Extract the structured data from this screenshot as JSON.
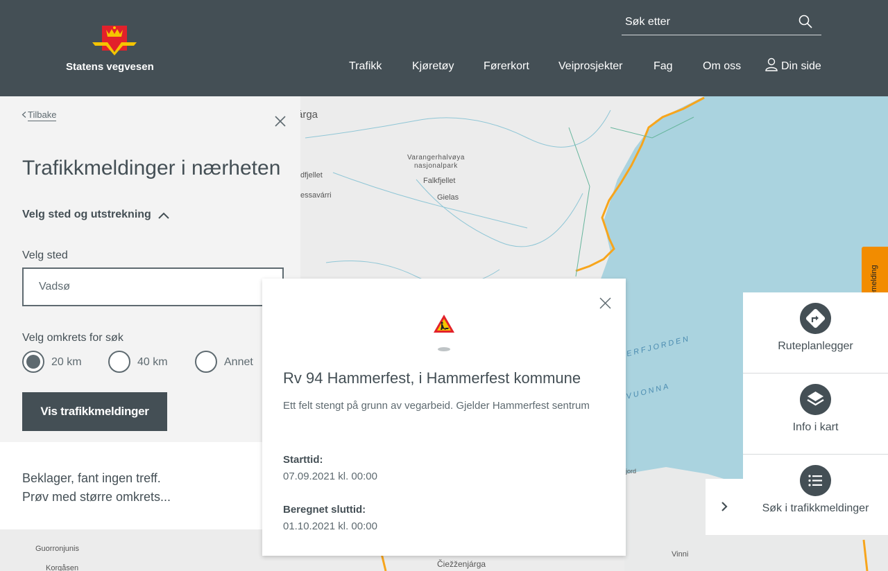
{
  "header": {
    "logo_text": "Statens vegvesen",
    "search_placeholder": "Søk etter",
    "nav": [
      "Trafikk",
      "Kjøretøy",
      "Førerkort",
      "Veiprosjekter",
      "Fag",
      "Om oss",
      "Din side"
    ]
  },
  "panel": {
    "back_label": "Tilbake",
    "title": "Trafikkmeldinger i nærheten",
    "section_label": "Velg sted og utstrekning",
    "place_label": "Velg sted",
    "place_value": "Vadsø",
    "radius_label": "Velg omkrets for søk",
    "radius_options": [
      "20 km",
      "40 km",
      "Annet"
    ],
    "radius_selected": "20 km",
    "submit_label": "Vis trafikkmeldinger",
    "empty_line1": "Beklager, fant ingen treff.",
    "empty_line2": "Prøv med større omkrets..."
  },
  "popup": {
    "icon": "roadwork-icon",
    "title": "Rv 94 Hammerfest, i Hammerfest kommune",
    "description": "Ett felt stengt på grunn av vegarbeid. Gjelder Hammerfest sentrum",
    "start_label": "Starttid:",
    "start_value": "07.09.2021 kl. 00:00",
    "end_label": "Beregnet sluttid:",
    "end_value": "01.10.2021 kl. 00:00"
  },
  "tools": [
    {
      "label": "Ruteplanlegger",
      "icon": "route-icon"
    },
    {
      "label": "Info i kart",
      "icon": "layers-icon"
    },
    {
      "label": "Søk i trafikkmeldinger",
      "icon": "list-icon"
    }
  ],
  "feedback_label": "Tilbakemelding",
  "map_labels": {
    "l1": "árga",
    "l2": "dfjellet",
    "l3": "essavárri",
    "l4": "Varangerhalvøya",
    "l5": "nasjonalpark",
    "l6": "Falkfjellet",
    "l7": "Gielas",
    "l8": "ERFJORDEN",
    "l9": "VUONNA",
    "l10": "jord",
    "l11": "Guorronjunis",
    "l12": "Korgåsen",
    "l13": "Čiežženjárga",
    "l14": "Vinni"
  },
  "colors": {
    "header_bg": "#444f55",
    "accent_orange": "#f28c00",
    "sea": "#aad3df",
    "road": "#f7a51c"
  }
}
